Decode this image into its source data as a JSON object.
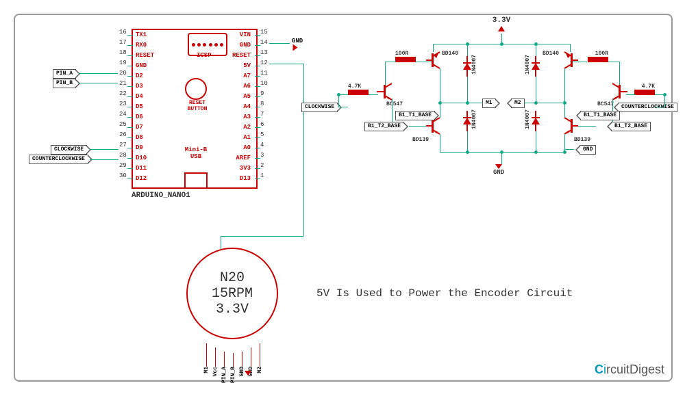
{
  "arduino": {
    "name": "ARDUINO_NANO1",
    "icsp": "ICSP",
    "reset_button": "RESET BUTTON",
    "usb": "Mini-B USB",
    "left_pins": [
      "TX1",
      "RX0",
      "RESET",
      "GND",
      "D2",
      "D3",
      "D4",
      "D5",
      "D6",
      "D7",
      "D8",
      "D9",
      "D10",
      "D11",
      "D12"
    ],
    "left_nums": [
      "16",
      "17",
      "18",
      "19",
      "20",
      "21",
      "22",
      "23",
      "24",
      "25",
      "26",
      "27",
      "28",
      "29",
      "30"
    ],
    "right_pins": [
      "VIN",
      "GND",
      "RESET",
      "5V",
      "A7",
      "A6",
      "A5",
      "A4",
      "A3",
      "A2",
      "A1",
      "A0",
      "AREF",
      "3V3",
      "D13"
    ],
    "right_nums": [
      "15",
      "14",
      "13",
      "12",
      "11",
      "10",
      "9",
      "8",
      "7",
      "6",
      "5",
      "4",
      "3",
      "2",
      "1"
    ]
  },
  "net_labels": {
    "pin_a": "PIN_A",
    "pin_b": "PIN_B",
    "cw": "CLOCKWISE",
    "ccw": "COUNTERCLOCKWISE",
    "gnd": "GND",
    "b1t1": "B1_T1_BASE",
    "b1t2": "B1_T2_BASE",
    "m1": "M1",
    "m2": "M2"
  },
  "motor": {
    "l1": "N20",
    "l2": "15RPM",
    "l3": "3.3V",
    "pins": [
      "M1",
      "Vcc",
      "PIN_A",
      "PIN_B",
      "GND",
      "GND",
      "M2"
    ]
  },
  "hbridge": {
    "vcc": "3.3V",
    "r100": "100R",
    "r47k": "4.7K",
    "bd140": "BD140",
    "bd139": "BD139",
    "bc547": "BC547",
    "d1n": "1N4007"
  },
  "text": {
    "encoder_note": "5V Is Used to Power the Encoder Circuit",
    "logo1": "C",
    "logo2": "i",
    "logo3": "rcuit",
    "logo4": "Digest"
  }
}
